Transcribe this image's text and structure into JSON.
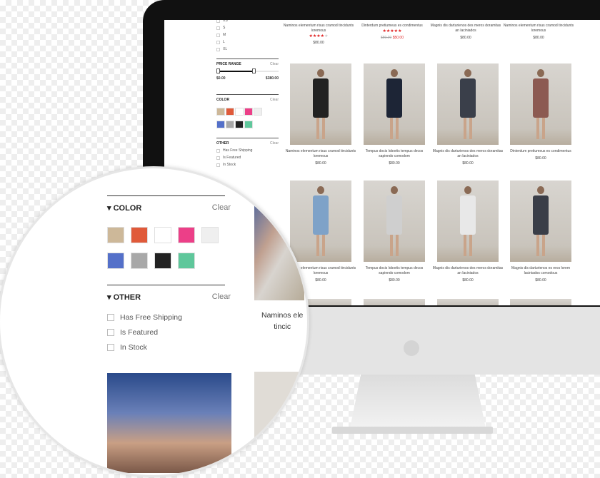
{
  "sidebar": {
    "sizes": [
      "XS",
      "S",
      "M",
      "L",
      "XL"
    ],
    "price_range": {
      "title": "PRICE RANGE",
      "clear": "Clear",
      "min": "$0.00",
      "max": "$380.00",
      "selected_fraction": 0.6
    },
    "color": {
      "title": "COLOR",
      "clear": "Clear",
      "swatches": [
        "#cdb899",
        "#e05a3a",
        "#ffffff",
        "#ec3f88",
        "#efefef",
        "#5470c9",
        "#a8a8a8",
        "#222222",
        "#5fc79b"
      ]
    },
    "other": {
      "title": "OTHER",
      "clear": "Clear",
      "options": [
        "Has Free Shipping",
        "Is Featured",
        "In Stock"
      ]
    }
  },
  "products": {
    "row0": [
      {
        "name": "Naminos elementum risus cramod tincidunts loremous",
        "rating": 4,
        "price": "$80.00"
      },
      {
        "name": "Dinterdum pretiumeus es condimentus",
        "rating": 5,
        "old_price": "$80.00",
        "price": "$50.00"
      },
      {
        "name": "Magnis dis darturienos des meros doramitas an laciniados",
        "price": "$80.00"
      },
      {
        "name": "Naminos elementum risus cramod tincidunts loremous",
        "price": "$80.00"
      }
    ],
    "row1": [
      {
        "name": "Naminos elementum risus cramod tincidunts loremous",
        "price": "$80.00",
        "color": "#222"
      },
      {
        "name": "Tempus docis lobortis tempus decos sapiendo comodom",
        "price": "$80.00",
        "color": "#1d2536"
      },
      {
        "name": "Magnis dis darturienos des meros doramitas an laciniados",
        "price": "$80.00",
        "color": "#3a3f4a"
      },
      {
        "name": "Dinterdum pretiumeus es condimentus",
        "price": "$80.00",
        "color": "#8c5a52"
      }
    ],
    "row2": [
      {
        "name": "Naminos elementum risus cramod tincidunts loremous",
        "price": "$80.00",
        "color": "#7ea2c8"
      },
      {
        "name": "Tempus docis lobortis tempus decos sapiendo comodom",
        "price": "$80.00",
        "color": "#cfcfcf"
      },
      {
        "name": "Magnis dis darturienos des meros doramitas an laciniados",
        "price": "$80.00",
        "color": "#e8e8e8"
      },
      {
        "name": "Magnis dis darturienos es eros lorem laciniados comodous",
        "price": "$80.00",
        "color": "#3a3e48"
      }
    ]
  },
  "lens": {
    "product_name_line1": "Naminos ele",
    "product_name_line2": "tincic"
  }
}
